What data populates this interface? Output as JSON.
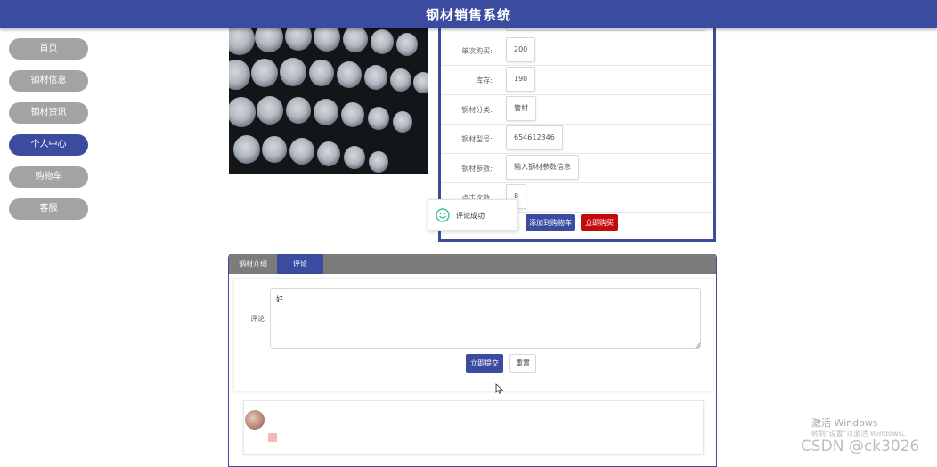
{
  "app": {
    "title": "钢材销售系统"
  },
  "nav": {
    "items": [
      {
        "label": "首页",
        "active": false
      },
      {
        "label": "钢材信息",
        "active": false
      },
      {
        "label": "钢材资讯",
        "active": false
      },
      {
        "label": "个人中心",
        "active": true
      },
      {
        "label": "购物车",
        "active": false
      },
      {
        "label": "客服",
        "active": false
      }
    ]
  },
  "detail": {
    "rows": [
      {
        "label": "单次购买:",
        "value": "200"
      },
      {
        "label": "库存:",
        "value": "198"
      },
      {
        "label": "钢材分类:",
        "value": "管材"
      },
      {
        "label": "钢材型号:",
        "value": "654612346"
      },
      {
        "label": "钢材参数:",
        "value": "输入钢材参数信息"
      },
      {
        "label": "点击次数:",
        "value": "8"
      }
    ],
    "add_to_cart": "添加到购物车",
    "buy_now": "立即购买"
  },
  "toast": {
    "message": "评论成功"
  },
  "tabs": [
    {
      "label": "钢材介绍",
      "active": false
    },
    {
      "label": "评论",
      "active": true
    }
  ],
  "comment_form": {
    "label": "评论",
    "value": "好",
    "submit": "立即提交",
    "reset": "重置"
  },
  "watermark": {
    "line1": "激活 Windows",
    "line2": "转到\"设置\"以激活 Windows。",
    "csdn": "CSDN @ck3026"
  },
  "colors": {
    "primary": "#3b4ba0",
    "nav_inactive": "#a3a3a3",
    "buy_red": "#c40b0b",
    "tab_bar": "#7c7c7c"
  }
}
